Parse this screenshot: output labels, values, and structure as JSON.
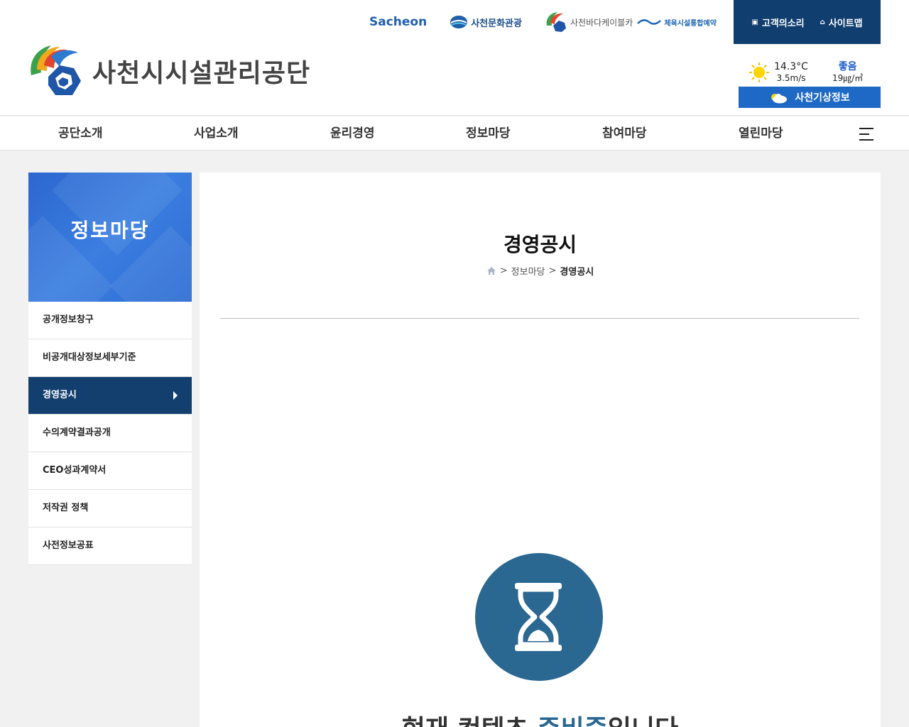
{
  "header": {
    "org_name": "사천시시설관리공단",
    "family_sites": {
      "sacheon_main": "Sacheon",
      "tourism": "사천문화관광",
      "cablecar": "사천바다케이블카",
      "sports_booking": "체육시설통합예약"
    },
    "util": {
      "voice_label": "고객의소리",
      "sitemap_label": "사이트맵"
    },
    "weather": {
      "temperature": "14.3°C",
      "wind": "3.5m/s",
      "air_quality": "좋음",
      "dust": "19㎍/㎥",
      "button_label": "사천기상정보"
    }
  },
  "gnb": {
    "items": [
      "공단소개",
      "사업소개",
      "윤리경영",
      "정보마당",
      "참여마당",
      "열린마당"
    ]
  },
  "sidebar": {
    "title": "정보마당",
    "items": [
      "공개정보창구",
      "비공개대상정보세부기준",
      "경영공시",
      "수의계약결과공개",
      "CEO성과계약서",
      "저작권 정책",
      "사전정보공표"
    ],
    "active_index": 2
  },
  "content": {
    "title": "경영공시",
    "breadcrumb": {
      "separator": ">",
      "parent": "정보마당",
      "current": "경영공시"
    },
    "message": {
      "prefix": "현재 컨텐츠 ",
      "highlight": "준비중",
      "suffix": "입니다"
    }
  },
  "colors": {
    "navy": "#133f6f",
    "blue": "#1f69c6",
    "accent": "#2a6791"
  },
  "icons": {
    "home": "home-icon",
    "hourglass": "hourglass-icon",
    "menu": "hamburger-icon",
    "sun": "sun-icon",
    "cloud": "cloud-icon"
  }
}
